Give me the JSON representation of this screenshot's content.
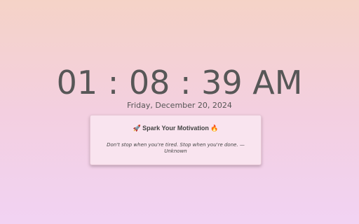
{
  "clock": {
    "time": "01 : 08 : 39 AM",
    "date": "Friday, December 20, 2024"
  },
  "motivation_card": {
    "title": "🚀 Spark Your Motivation 🔥",
    "quote": "Don't stop when you're tired. Stop when you're done. —",
    "author": "Unknown"
  },
  "colors": {
    "background_top": "#f5d3c7",
    "background_bottom": "#f2d3f3",
    "card_background": "#f9e4ef",
    "text": "#575757"
  }
}
